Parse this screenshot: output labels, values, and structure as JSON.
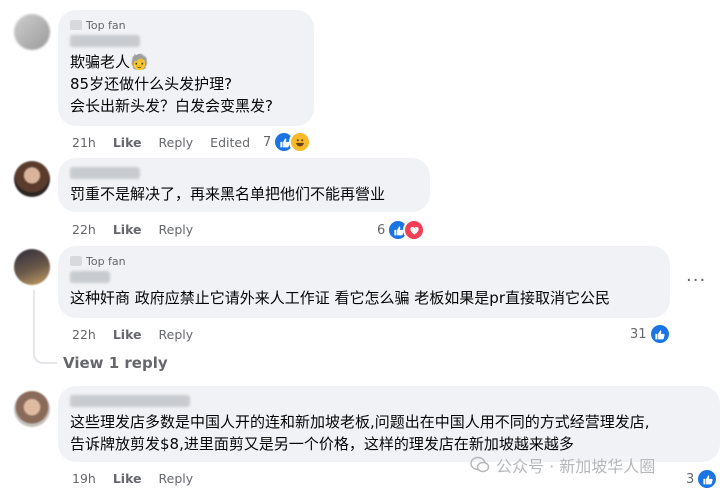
{
  "comments": [
    {
      "badge": "Top fan",
      "lines": "欺骗老人🧓\n85岁还做什么头发护理?\n会长出新头发？白发会变黑发?",
      "time": "21h",
      "like": "Like",
      "reply": "Reply",
      "edited": "Edited",
      "reaction_count": "7",
      "reactions": [
        "like-icon",
        "haha-icon"
      ]
    },
    {
      "badge": "",
      "lines": "罚重不是解决了，再来黑名单把他们不能再營业",
      "time": "22h",
      "like": "Like",
      "reply": "Reply",
      "reaction_count": "6",
      "reactions": [
        "like-icon",
        "heart-icon"
      ]
    },
    {
      "badge": "Top fan",
      "lines": "这种奸商 政府应禁止它请外来人工作证 看它怎么骗 老板如果是pr直接取消它公民",
      "time": "22h",
      "like": "Like",
      "reply": "Reply",
      "reaction_count": "31",
      "reactions": [
        "like-icon"
      ],
      "view_reply": "View 1 reply",
      "more": "···"
    },
    {
      "badge": "",
      "lines": "这些理发店多数是中国人开的连和新加坡老板,问题出在中国人用不同的方式经营理发店,\n告诉牌放剪发$8,进里面剪又是另一个价格，这样的理发店在新加坡越来越多",
      "time": "19h",
      "like": "Like",
      "reply": "Reply",
      "reaction_count": "3",
      "reactions": [
        "like-icon"
      ]
    }
  ],
  "watermark": "公众号 · 新加坡华人圈",
  "colors": {
    "bubble": "#f0f2f5",
    "like_blue": "#1b74e4",
    "heart_red": "#f33e58",
    "haha_yellow": "#f7b928",
    "meta_gray": "#65676b"
  }
}
